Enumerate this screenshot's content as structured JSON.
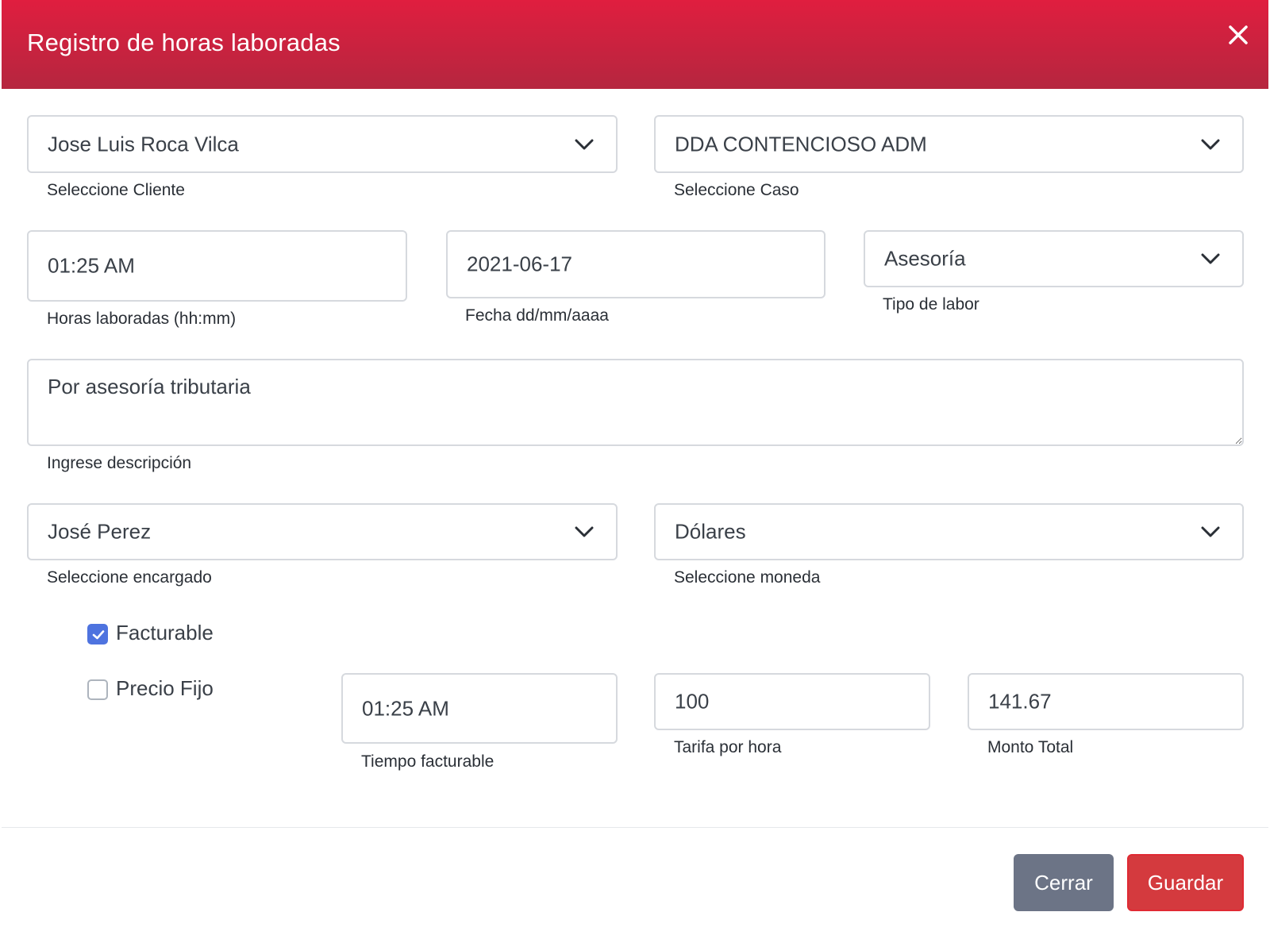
{
  "modal": {
    "title": "Registro de horas laboradas"
  },
  "form": {
    "cliente": {
      "value": "Jose Luis Roca Vilca",
      "label": "Seleccione Cliente"
    },
    "caso": {
      "value": "DDA CONTENCIOSO ADM",
      "label": "Seleccione Caso"
    },
    "horas": {
      "value": "01:25 AM",
      "label": "Horas laboradas (hh:mm)"
    },
    "fecha": {
      "value": "2021-06-17",
      "label": "Fecha dd/mm/aaaa"
    },
    "tipo_labor": {
      "value": "Asesoría",
      "label": "Tipo de labor"
    },
    "descripcion": {
      "value": "Por asesoría tributaria",
      "label": "Ingrese descripción"
    },
    "encargado": {
      "value": "José Perez",
      "label": "Seleccione encargado"
    },
    "moneda": {
      "value": "Dólares",
      "label": "Seleccione moneda"
    },
    "facturable": {
      "label": "Facturable",
      "checked": true
    },
    "precio_fijo": {
      "label": "Precio Fijo",
      "checked": false
    },
    "tiempo_facturable": {
      "value": "01:25 AM",
      "label": "Tiempo facturable"
    },
    "tarifa": {
      "value": "100",
      "label": "Tarifa por hora"
    },
    "monto_total": {
      "value": "141.67",
      "label": "Monto Total"
    }
  },
  "footer": {
    "close_label": "Cerrar",
    "save_label": "Guardar"
  },
  "colors": {
    "header_top": "#e01e3f",
    "header_bottom": "#b5263f",
    "checkbox_accent": "#4e73df",
    "close_button": "#6c7486",
    "save_button": "#d43a3e"
  },
  "icons": {
    "close": "close-icon",
    "dropdown": "chevron-down-icon",
    "check": "check-icon"
  }
}
